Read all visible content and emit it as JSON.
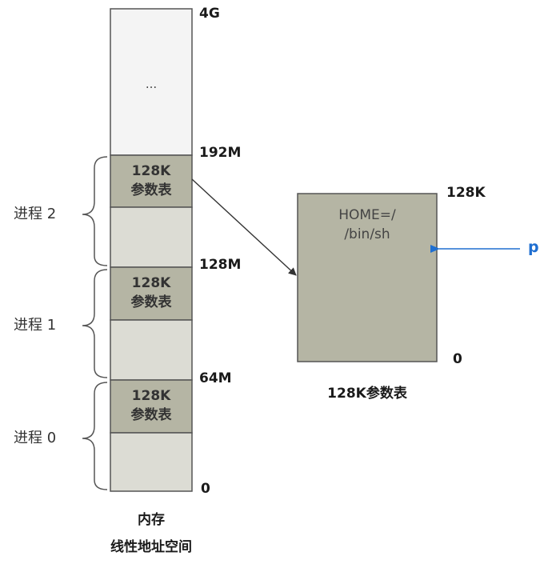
{
  "memory": {
    "top_dots": "...",
    "caption_line1": "内存",
    "caption_line2": "线性地址空间",
    "addresses": [
      "4G",
      "192M",
      "128M",
      "64M",
      "0"
    ],
    "param_block": {
      "line1": "128K",
      "line2": "参数表"
    },
    "processes": [
      "进程 2",
      "进程 1",
      "进程 0"
    ]
  },
  "param_table": {
    "env_line1": "HOME=/",
    "env_line2": "/bin/sh",
    "top_label": "128K",
    "bottom_label": "0",
    "pointer_label": "p",
    "caption": "128K参数表"
  },
  "colors": {
    "param_fill": "#b5b5a4",
    "segment_fill": "#dcdcd4",
    "top_fill": "#f4f4f4",
    "pointer": "#1f6fd1",
    "outline": "#555555"
  }
}
